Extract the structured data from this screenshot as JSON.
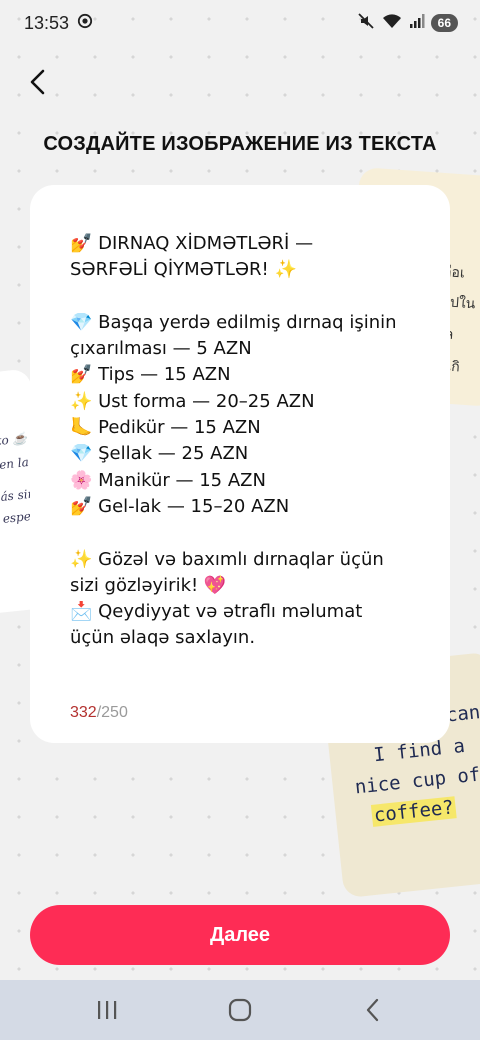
{
  "status_bar": {
    "time": "13:53",
    "battery": "66",
    "icons": [
      "whatsapp-status-icon",
      "mute-icon",
      "wifi-icon",
      "signal-icon",
      "battery-icon"
    ]
  },
  "header": {
    "back_icon": "chevron-left-icon",
    "title": "СОЗДАЙТЕ ИЗОБРАЖЕНИЕ ИЗ ТЕКСТА"
  },
  "editor": {
    "text": "💅 DIRNAQ XİDMƏTLƏRİ —\nSƏRFƏLİ QİYMƏTLƏR! ✨\n\n💎 Başqa yerdə edilmiş dırnaq işinin\nçıxarılması — 5 AZN\n💅 Tips — 15 AZN\n✨ Ust forma — 20–25 AZN\n🦶 Pedikür — 15 AZN\n💎 Şellak — 25 AZN\n🌸 Manikür — 15 AZN\n💅 Gel-lak — 15–20 AZN\n\n✨ Gözəl və baxımlı dırnaqlar üçün\nsizi gözləyirik! 💖\n📩 Qeydiyyat və ətraflı məlumat\nüçün əlaqə saxlayın.",
    "char_count": "332",
    "char_limit": "/250",
    "count_color": "#b3312f"
  },
  "background_cards": {
    "right_bottom_lines": [
      "can",
      "I find a",
      "nice cup of",
      "coffee?"
    ],
    "left_fragments": [
      "to ☕",
      "en la",
      "ás sim",
      "especi"
    ],
    "right_top_fragments": [
      "ถือเ",
      "ไปใน",
      "ล",
      "เกิ"
    ]
  },
  "footer": {
    "next_label": "Далее",
    "accent": "#fe2c55"
  },
  "nav_bar": {
    "buttons": [
      "recent-apps-icon",
      "home-icon",
      "back-icon"
    ]
  }
}
